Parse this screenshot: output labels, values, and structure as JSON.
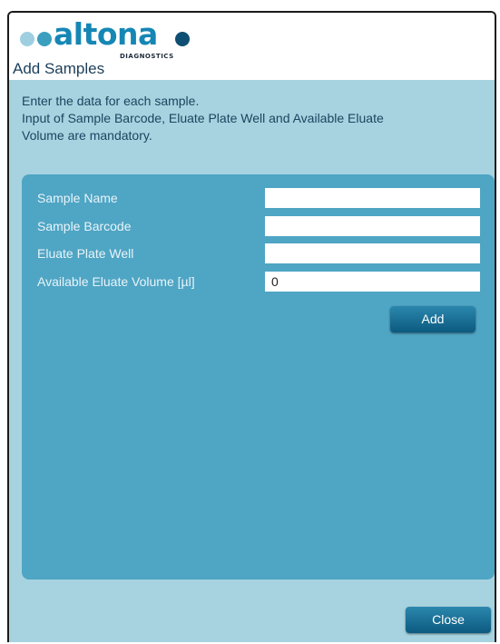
{
  "header": {
    "logo_brand": "altona",
    "logo_sub": "DIAGNOSTICS",
    "title": "Add Samples"
  },
  "intro": {
    "line1": "Enter the data for each sample.",
    "line2": "Input of Sample Barcode, Eluate Plate Well and Available Eluate",
    "line3": "Volume are mandatory."
  },
  "form": {
    "sample_name": {
      "label": "Sample Name",
      "value": ""
    },
    "sample_barcode": {
      "label": "Sample Barcode",
      "value": ""
    },
    "eluate_plate_well": {
      "label": "Eluate Plate Well",
      "value": ""
    },
    "available_eluate_volume": {
      "label": "Available Eluate Volume [µl]",
      "value": "0"
    },
    "add_label": "Add"
  },
  "footer": {
    "close_label": "Close"
  },
  "colors": {
    "brand": "#1687b5",
    "dialog_bg": "#a7d3e0",
    "panel_bg": "#4fa5c4",
    "button": "#0c5a80"
  }
}
